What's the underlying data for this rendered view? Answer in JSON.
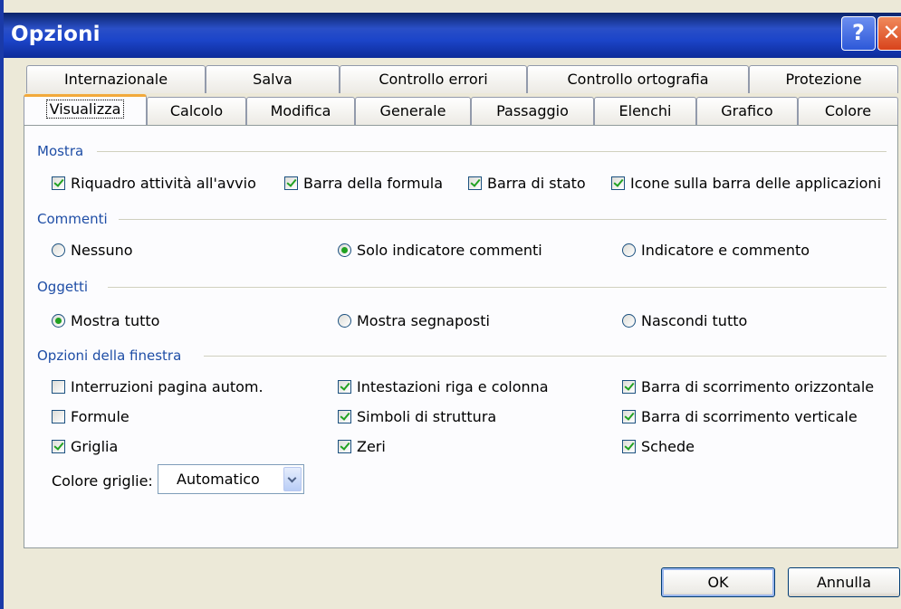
{
  "window": {
    "title": "Opzioni",
    "help_glyph": "?",
    "close_glyph": "✕",
    "accent": "#0a246a"
  },
  "tabs_row1": [
    "Internazionale",
    "Salva",
    "Controllo errori",
    "Controllo ortografia",
    "Protezione"
  ],
  "tabs_row2": [
    "Visualizza",
    "Calcolo",
    "Modifica",
    "Generale",
    "Passaggio",
    "Elenchi",
    "Grafico",
    "Colore"
  ],
  "active_tab": "Visualizza",
  "mostra": {
    "label": "Mostra",
    "items": [
      {
        "label": "Riquadro attività all'avvio",
        "checked": true
      },
      {
        "label": "Barra della formula",
        "checked": true
      },
      {
        "label": "Barra di stato",
        "checked": true
      },
      {
        "label": "Icone sulla barra delle applicazioni",
        "checked": true
      }
    ]
  },
  "commenti": {
    "label": "Commenti",
    "options": [
      {
        "label": "Nessuno",
        "selected": false
      },
      {
        "label": "Solo indicatore commenti",
        "selected": true
      },
      {
        "label": "Indicatore e commento",
        "selected": false
      }
    ]
  },
  "oggetti": {
    "label": "Oggetti",
    "options": [
      {
        "label": "Mostra tutto",
        "selected": true
      },
      {
        "label": "Mostra segnaposti",
        "selected": false
      },
      {
        "label": "Nascondi tutto",
        "selected": false
      }
    ]
  },
  "finestra": {
    "label": "Opzioni della finestra",
    "items": [
      {
        "label": "Interruzioni pagina autom.",
        "checked": false
      },
      {
        "label": "Intestazioni riga e colonna",
        "checked": true
      },
      {
        "label": "Barra di scorrimento orizzontale",
        "checked": true
      },
      {
        "label": "Formule",
        "checked": false
      },
      {
        "label": "Simboli di struttura",
        "checked": true
      },
      {
        "label": "Barra di scorrimento verticale",
        "checked": true
      },
      {
        "label": "Griglia",
        "checked": true
      },
      {
        "label": "Zeri",
        "checked": true
      },
      {
        "label": "Schede",
        "checked": true
      }
    ],
    "gridcolor_label": "Colore griglie:",
    "gridcolor_value": "Automatico"
  },
  "buttons": {
    "ok": "OK",
    "cancel": "Annulla"
  }
}
